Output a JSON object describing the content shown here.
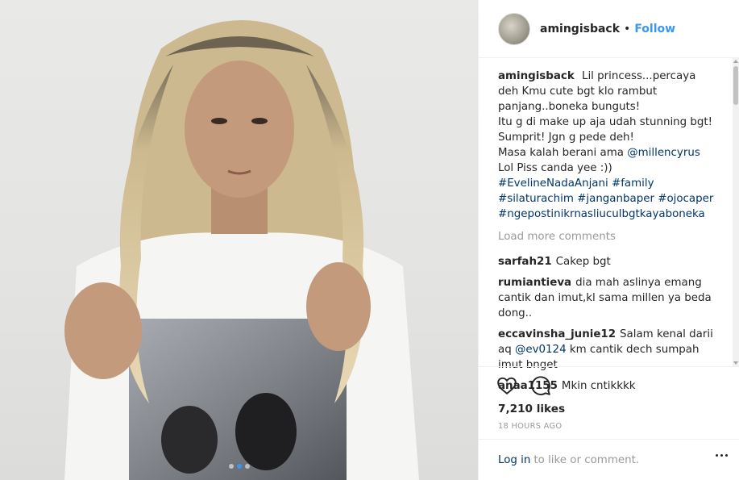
{
  "post": {
    "username": "amingisback",
    "separator": "•",
    "follow_label": "Follow",
    "caption": {
      "username": "amingisback",
      "line1": "Lil princess...percaya deh Kmu cute bgt klo rambut panjang..boneka bunguts!",
      "line2": "Itu g di make up aja udah stunning bgt! Sumprit! Jgn g pede deh!",
      "line3_pre": "Masa kalah berani ama ",
      "line3_mention": "@millencyrus",
      "line3_post": " Lol Piss canda yee :))",
      "hashtags": [
        "#EvelineNadaAnjani",
        "#family",
        "#silaturachim",
        "#janganbaper",
        "#ojocaper",
        "#ngepostinikrnasliuculbgtkayaboneka"
      ]
    },
    "load_more": "Load more comments",
    "comments": [
      {
        "user": "sarfah21",
        "text": "Cakep bgt"
      },
      {
        "user": "rumiantieva",
        "text": "dia mah aslinya emang cantik dan imut,kl sama millen ya beda dong.."
      },
      {
        "user": "eccavinsha_junie12",
        "text_pre": "Salam kenal darii aq ",
        "mention": "@ev0124",
        "text_post": " km cantik dech sumpah imut bnget"
      },
      {
        "user": "anaa1155",
        "text": "Mkin cntikkkk"
      }
    ],
    "likes": "7,210 likes",
    "timestamp": "18 HOURS AGO",
    "login_link": "Log in",
    "login_rest": "to like or comment.",
    "carousel": {
      "count": 3,
      "active_index": 1
    },
    "icons": {
      "like": "heart-icon",
      "comment": "comment-bubble-icon",
      "more": "more-options-icon"
    },
    "colors": {
      "link_blue": "#3897f0",
      "hashtag_navy": "#003569",
      "text": "#262626",
      "muted": "#999999"
    }
  }
}
